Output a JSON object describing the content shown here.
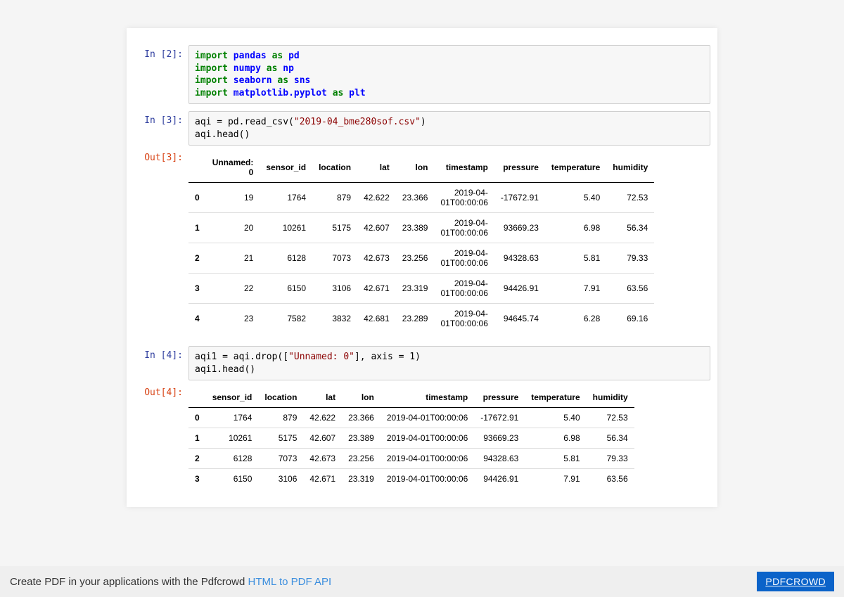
{
  "cells": {
    "in2": {
      "prompt": "In [2]:"
    },
    "in3": {
      "prompt": "In [3]:"
    },
    "out3": {
      "prompt": "Out[3]:"
    },
    "in4": {
      "prompt": "In [4]:"
    },
    "out4": {
      "prompt": "Out[4]:"
    }
  },
  "code": {
    "import_kw": "import",
    "as_kw": "as",
    "pandas": "pandas",
    "numpy": "numpy",
    "seaborn": "seaborn",
    "mpl": "matplotlib.pyplot",
    "pd": "pd",
    "np": "np",
    "sns": "sns",
    "plt": "plt",
    "in3_line1a": "aqi = pd.read_csv(",
    "in3_str": "\"2019-04_bme280sof.csv\"",
    "in3_line1b": ")",
    "in3_line2": "aqi.head()",
    "in4_line1a": "aqi1 = aqi.drop([",
    "in4_str": "\"Unnamed: 0\"",
    "in4_line1b": "], axis = 1)",
    "in4_line2": "aqi1.head()"
  },
  "table3": {
    "headers": [
      "",
      "Unnamed: 0",
      "sensor_id",
      "location",
      "lat",
      "lon",
      "timestamp",
      "pressure",
      "temperature",
      "humidity"
    ],
    "rows": [
      [
        "0",
        "19",
        "1764",
        "879",
        "42.622",
        "23.366",
        "2019-04-01T00:00:06",
        "-17672.91",
        "5.40",
        "72.53"
      ],
      [
        "1",
        "20",
        "10261",
        "5175",
        "42.607",
        "23.389",
        "2019-04-01T00:00:06",
        "93669.23",
        "6.98",
        "56.34"
      ],
      [
        "2",
        "21",
        "6128",
        "7073",
        "42.673",
        "23.256",
        "2019-04-01T00:00:06",
        "94328.63",
        "5.81",
        "79.33"
      ],
      [
        "3",
        "22",
        "6150",
        "3106",
        "42.671",
        "23.319",
        "2019-04-01T00:00:06",
        "94426.91",
        "7.91",
        "63.56"
      ],
      [
        "4",
        "23",
        "7582",
        "3832",
        "42.681",
        "23.289",
        "2019-04-01T00:00:06",
        "94645.74",
        "6.28",
        "69.16"
      ]
    ]
  },
  "table4": {
    "headers": [
      "",
      "sensor_id",
      "location",
      "lat",
      "lon",
      "timestamp",
      "pressure",
      "temperature",
      "humidity"
    ],
    "rows": [
      [
        "0",
        "1764",
        "879",
        "42.622",
        "23.366",
        "2019-04-01T00:00:06",
        "-17672.91",
        "5.40",
        "72.53"
      ],
      [
        "1",
        "10261",
        "5175",
        "42.607",
        "23.389",
        "2019-04-01T00:00:06",
        "93669.23",
        "6.98",
        "56.34"
      ],
      [
        "2",
        "6128",
        "7073",
        "42.673",
        "23.256",
        "2019-04-01T00:00:06",
        "94328.63",
        "5.81",
        "79.33"
      ],
      [
        "3",
        "6150",
        "3106",
        "42.671",
        "23.319",
        "2019-04-01T00:00:06",
        "94426.91",
        "7.91",
        "63.56"
      ]
    ]
  },
  "footer": {
    "text_prefix": "Create PDF in your applications with the Pdfcrowd ",
    "link_text": "HTML to PDF API",
    "badge": "PDFCROWD"
  }
}
